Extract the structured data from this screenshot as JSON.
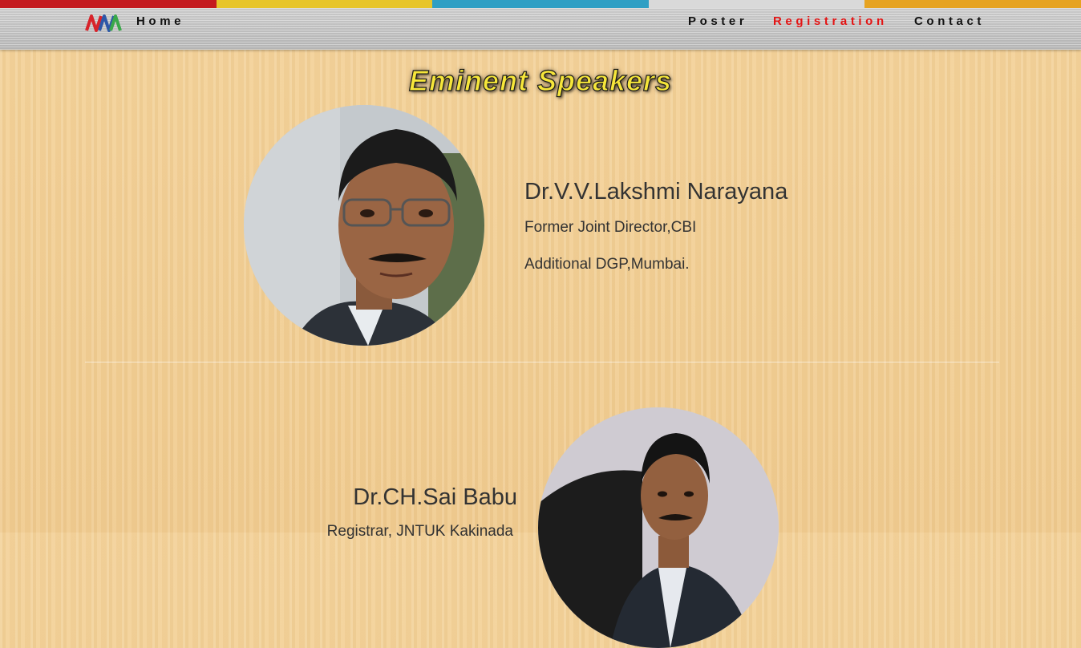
{
  "header": {
    "strip_colors": [
      "#c41a1f",
      "#e7c52b",
      "#2f9fc4",
      "#d9d9d9",
      "#e6a321"
    ],
    "logo_text": "",
    "nav": {
      "home": "Home",
      "poster": "Poster",
      "registration": "Registration",
      "contact": "Contact"
    },
    "active_color": "#e31414"
  },
  "section_title": "Eminent Speakers",
  "speakers": [
    {
      "name": "Dr.V.V.Lakshmi Narayana",
      "details": [
        "Former Joint Director,CBI",
        "Additional DGP,Mumbai."
      ]
    },
    {
      "name": "Dr.CH.Sai Babu",
      "details": [
        "Registrar, JNTUK Kakinada"
      ]
    }
  ]
}
